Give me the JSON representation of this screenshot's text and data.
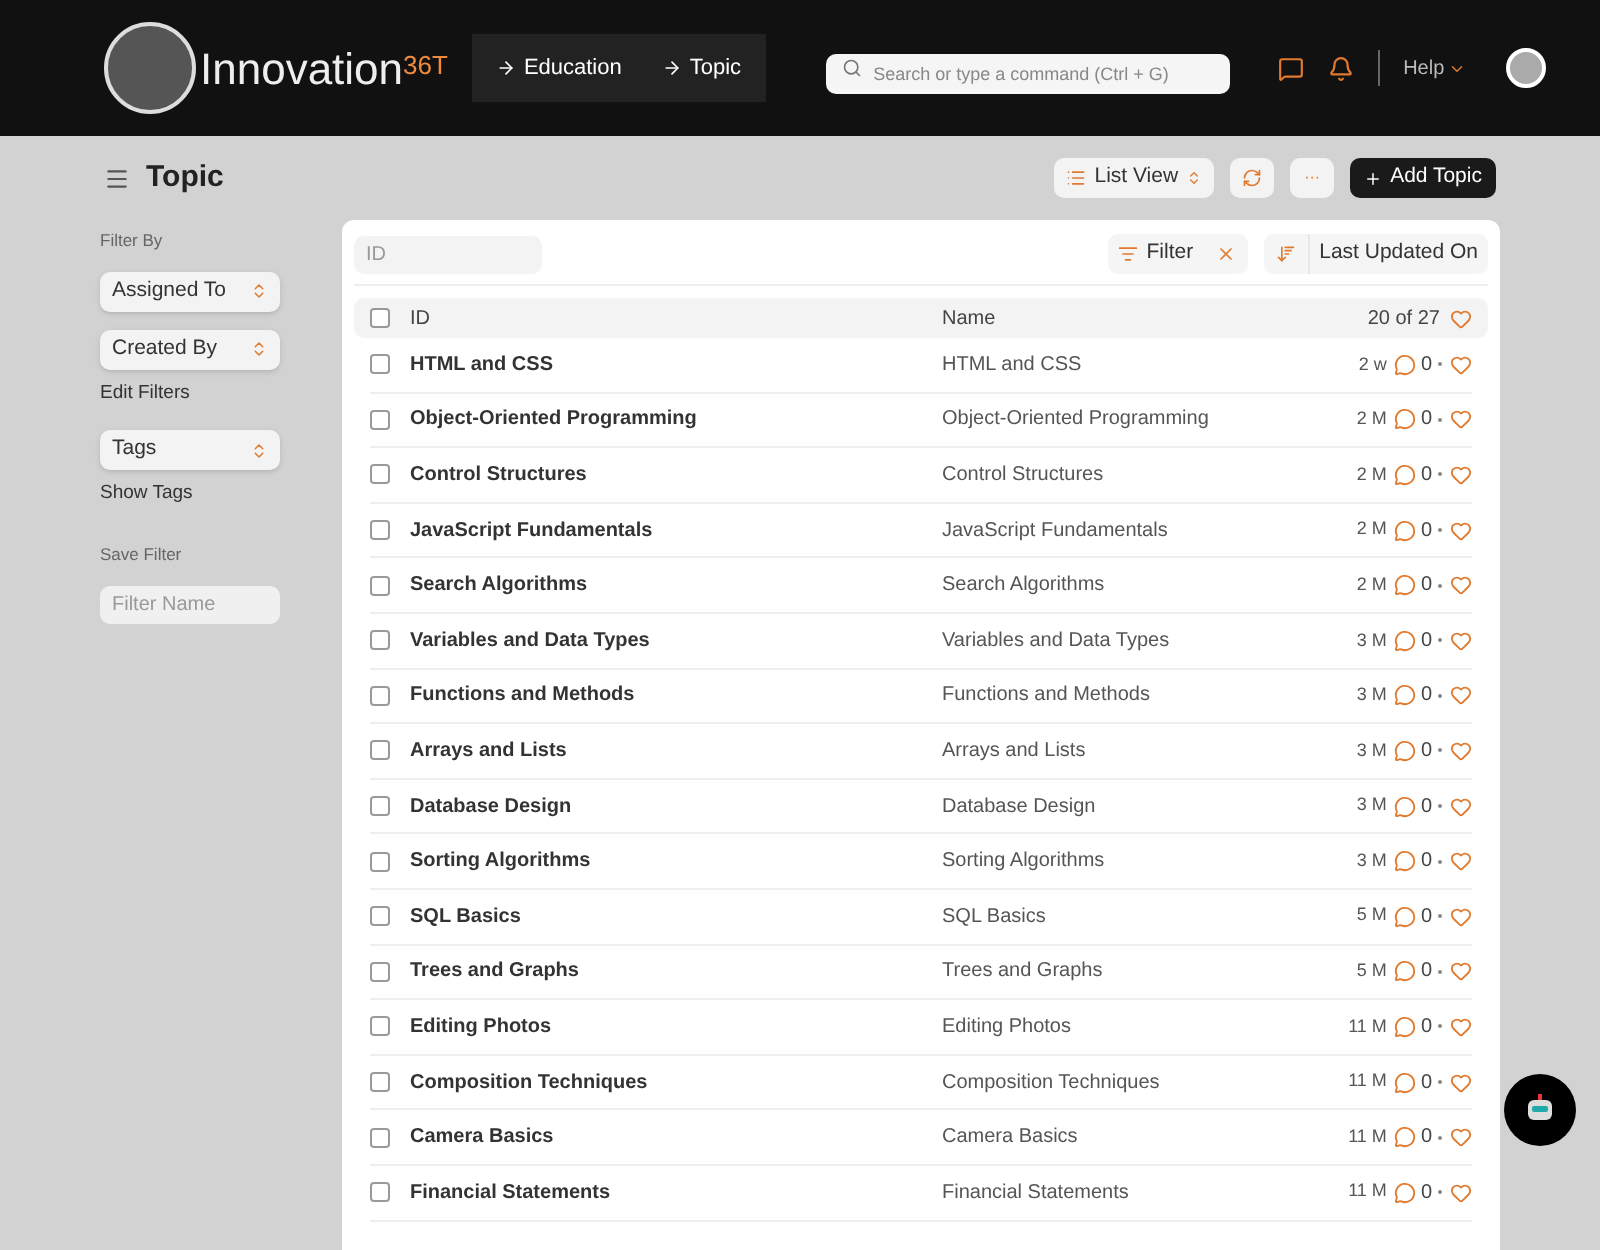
{
  "brand": {
    "name": "Innovation",
    "superscript": "36T"
  },
  "breadcrumbs": [
    "Education",
    "Topic"
  ],
  "search": {
    "placeholder": "Search or type a command (Ctrl + G)"
  },
  "help": "Help",
  "page_title": "Topic",
  "toolbar": {
    "view": "List View",
    "add": "Add Topic",
    "more": "···"
  },
  "sidebar": {
    "filter_by": "Filter By",
    "filters": [
      "Assigned To",
      "Created By"
    ],
    "edit_filters": "Edit Filters",
    "tags": "Tags",
    "show_tags": "Show Tags",
    "save_filter": "Save Filter",
    "filter_name_placeholder": "Filter Name"
  },
  "list_filters": {
    "id_placeholder": "ID",
    "filter": "Filter",
    "sort": "Last Updated On"
  },
  "table": {
    "columns": [
      "ID",
      "Name"
    ],
    "count": "20 of 27",
    "all_checked": false,
    "rows": [
      {
        "id": "HTML and CSS",
        "name": "HTML and CSS",
        "age": "2 w",
        "comments": "0",
        "checked": false
      },
      {
        "id": "Object-Oriented Programming",
        "name": "Object-Oriented Programming",
        "age": "2 M",
        "comments": "0",
        "checked": false
      },
      {
        "id": "Control Structures",
        "name": "Control Structures",
        "age": "2 M",
        "comments": "0",
        "checked": false
      },
      {
        "id": "JavaScript Fundamentals",
        "name": "JavaScript Fundamentals",
        "age": "2 M",
        "comments": "0",
        "checked": false
      },
      {
        "id": "Search Algorithms",
        "name": "Search Algorithms",
        "age": "2 M",
        "comments": "0",
        "checked": false
      },
      {
        "id": "Variables and Data Types",
        "name": "Variables and Data Types",
        "age": "3 M",
        "comments": "0",
        "checked": false
      },
      {
        "id": "Functions and Methods",
        "name": "Functions and Methods",
        "age": "3 M",
        "comments": "0",
        "checked": false
      },
      {
        "id": "Arrays and Lists",
        "name": "Arrays and Lists",
        "age": "3 M",
        "comments": "0",
        "checked": false
      },
      {
        "id": "Database Design",
        "name": "Database Design",
        "age": "3 M",
        "comments": "0",
        "checked": false
      },
      {
        "id": "Sorting Algorithms",
        "name": "Sorting Algorithms",
        "age": "3 M",
        "comments": "0",
        "checked": false
      },
      {
        "id": "SQL Basics",
        "name": "SQL Basics",
        "age": "5 M",
        "comments": "0",
        "checked": false
      },
      {
        "id": "Trees and Graphs",
        "name": "Trees and Graphs",
        "age": "5 M",
        "comments": "0",
        "checked": false
      },
      {
        "id": "Editing Photos",
        "name": "Editing Photos",
        "age": "11 M",
        "comments": "0",
        "checked": false
      },
      {
        "id": "Composition Techniques",
        "name": "Composition Techniques",
        "age": "11 M",
        "comments": "0",
        "checked": false
      },
      {
        "id": "Camera Basics",
        "name": "Camera Basics",
        "age": "11 M",
        "comments": "0",
        "checked": false
      },
      {
        "id": "Financial Statements",
        "name": "Financial Statements",
        "age": "11 M",
        "comments": "0",
        "checked": false
      }
    ]
  }
}
